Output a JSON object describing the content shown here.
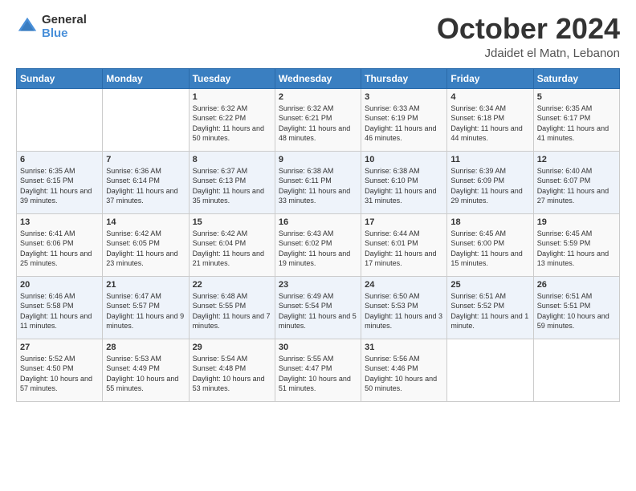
{
  "logo": {
    "line1": "General",
    "line2": "Blue"
  },
  "title": "October 2024",
  "subtitle": "Jdaidet el Matn, Lebanon",
  "days_of_week": [
    "Sunday",
    "Monday",
    "Tuesday",
    "Wednesday",
    "Thursday",
    "Friday",
    "Saturday"
  ],
  "weeks": [
    [
      {
        "day": "",
        "info": ""
      },
      {
        "day": "",
        "info": ""
      },
      {
        "day": "1",
        "info": "Sunrise: 6:32 AM\nSunset: 6:22 PM\nDaylight: 11 hours and 50 minutes."
      },
      {
        "day": "2",
        "info": "Sunrise: 6:32 AM\nSunset: 6:21 PM\nDaylight: 11 hours and 48 minutes."
      },
      {
        "day": "3",
        "info": "Sunrise: 6:33 AM\nSunset: 6:19 PM\nDaylight: 11 hours and 46 minutes."
      },
      {
        "day": "4",
        "info": "Sunrise: 6:34 AM\nSunset: 6:18 PM\nDaylight: 11 hours and 44 minutes."
      },
      {
        "day": "5",
        "info": "Sunrise: 6:35 AM\nSunset: 6:17 PM\nDaylight: 11 hours and 41 minutes."
      }
    ],
    [
      {
        "day": "6",
        "info": "Sunrise: 6:35 AM\nSunset: 6:15 PM\nDaylight: 11 hours and 39 minutes."
      },
      {
        "day": "7",
        "info": "Sunrise: 6:36 AM\nSunset: 6:14 PM\nDaylight: 11 hours and 37 minutes."
      },
      {
        "day": "8",
        "info": "Sunrise: 6:37 AM\nSunset: 6:13 PM\nDaylight: 11 hours and 35 minutes."
      },
      {
        "day": "9",
        "info": "Sunrise: 6:38 AM\nSunset: 6:11 PM\nDaylight: 11 hours and 33 minutes."
      },
      {
        "day": "10",
        "info": "Sunrise: 6:38 AM\nSunset: 6:10 PM\nDaylight: 11 hours and 31 minutes."
      },
      {
        "day": "11",
        "info": "Sunrise: 6:39 AM\nSunset: 6:09 PM\nDaylight: 11 hours and 29 minutes."
      },
      {
        "day": "12",
        "info": "Sunrise: 6:40 AM\nSunset: 6:07 PM\nDaylight: 11 hours and 27 minutes."
      }
    ],
    [
      {
        "day": "13",
        "info": "Sunrise: 6:41 AM\nSunset: 6:06 PM\nDaylight: 11 hours and 25 minutes."
      },
      {
        "day": "14",
        "info": "Sunrise: 6:42 AM\nSunset: 6:05 PM\nDaylight: 11 hours and 23 minutes."
      },
      {
        "day": "15",
        "info": "Sunrise: 6:42 AM\nSunset: 6:04 PM\nDaylight: 11 hours and 21 minutes."
      },
      {
        "day": "16",
        "info": "Sunrise: 6:43 AM\nSunset: 6:02 PM\nDaylight: 11 hours and 19 minutes."
      },
      {
        "day": "17",
        "info": "Sunrise: 6:44 AM\nSunset: 6:01 PM\nDaylight: 11 hours and 17 minutes."
      },
      {
        "day": "18",
        "info": "Sunrise: 6:45 AM\nSunset: 6:00 PM\nDaylight: 11 hours and 15 minutes."
      },
      {
        "day": "19",
        "info": "Sunrise: 6:45 AM\nSunset: 5:59 PM\nDaylight: 11 hours and 13 minutes."
      }
    ],
    [
      {
        "day": "20",
        "info": "Sunrise: 6:46 AM\nSunset: 5:58 PM\nDaylight: 11 hours and 11 minutes."
      },
      {
        "day": "21",
        "info": "Sunrise: 6:47 AM\nSunset: 5:57 PM\nDaylight: 11 hours and 9 minutes."
      },
      {
        "day": "22",
        "info": "Sunrise: 6:48 AM\nSunset: 5:55 PM\nDaylight: 11 hours and 7 minutes."
      },
      {
        "day": "23",
        "info": "Sunrise: 6:49 AM\nSunset: 5:54 PM\nDaylight: 11 hours and 5 minutes."
      },
      {
        "day": "24",
        "info": "Sunrise: 6:50 AM\nSunset: 5:53 PM\nDaylight: 11 hours and 3 minutes."
      },
      {
        "day": "25",
        "info": "Sunrise: 6:51 AM\nSunset: 5:52 PM\nDaylight: 11 hours and 1 minute."
      },
      {
        "day": "26",
        "info": "Sunrise: 6:51 AM\nSunset: 5:51 PM\nDaylight: 10 hours and 59 minutes."
      }
    ],
    [
      {
        "day": "27",
        "info": "Sunrise: 5:52 AM\nSunset: 4:50 PM\nDaylight: 10 hours and 57 minutes."
      },
      {
        "day": "28",
        "info": "Sunrise: 5:53 AM\nSunset: 4:49 PM\nDaylight: 10 hours and 55 minutes."
      },
      {
        "day": "29",
        "info": "Sunrise: 5:54 AM\nSunset: 4:48 PM\nDaylight: 10 hours and 53 minutes."
      },
      {
        "day": "30",
        "info": "Sunrise: 5:55 AM\nSunset: 4:47 PM\nDaylight: 10 hours and 51 minutes."
      },
      {
        "day": "31",
        "info": "Sunrise: 5:56 AM\nSunset: 4:46 PM\nDaylight: 10 hours and 50 minutes."
      },
      {
        "day": "",
        "info": ""
      },
      {
        "day": "",
        "info": ""
      }
    ]
  ]
}
